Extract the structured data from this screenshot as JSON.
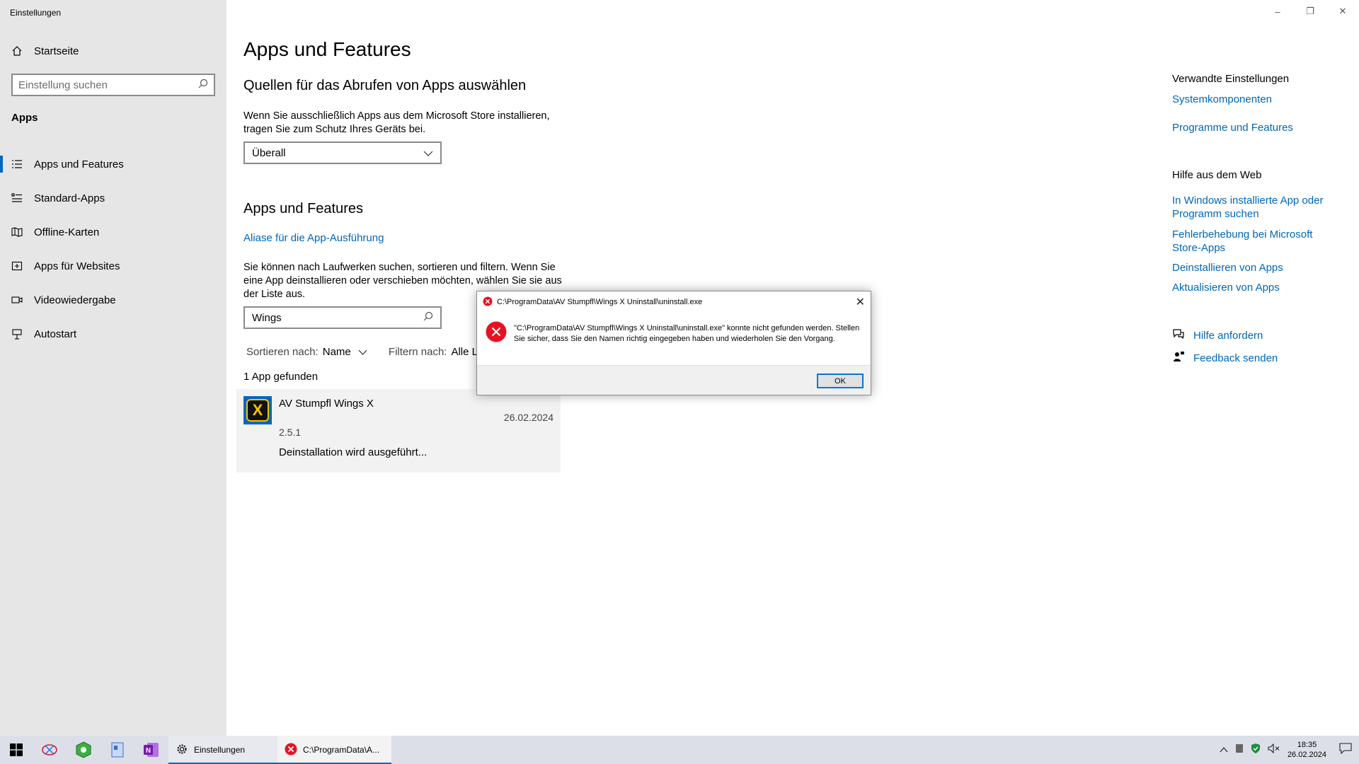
{
  "window": {
    "title": "Einstellungen",
    "controls": {
      "minimize": "–",
      "restore": "❐",
      "close": "✕"
    }
  },
  "sidebar": {
    "home": "Startseite",
    "search_placeholder": "Einstellung suchen",
    "section": "Apps",
    "items": [
      {
        "label": "Apps und Features",
        "icon": "list-icon",
        "active": true
      },
      {
        "label": "Standard-Apps",
        "icon": "default-apps-icon",
        "active": false
      },
      {
        "label": "Offline-Karten",
        "icon": "map-icon",
        "active": false
      },
      {
        "label": "Apps für Websites",
        "icon": "web-apps-icon",
        "active": false
      },
      {
        "label": "Videowiedergabe",
        "icon": "video-icon",
        "active": false
      },
      {
        "label": "Autostart",
        "icon": "startup-icon",
        "active": false
      }
    ]
  },
  "main": {
    "title": "Apps und Features",
    "source_heading": "Quellen für das Abrufen von Apps auswählen",
    "source_text": "Wenn Sie ausschließlich Apps aus dem Microsoft Store installieren, tragen Sie zum Schutz Ihres Geräts bei.",
    "source_value": "Überall",
    "apps_heading": "Apps und Features",
    "alias_link": "Aliase für die App-Ausführung",
    "search_text": "Sie können nach Laufwerken suchen, sortieren und filtern. Wenn Sie eine App deinstallieren oder verschieben möchten, wählen Sie sie aus der Liste aus.",
    "search_value": "Wings",
    "sort_label": "Sortieren nach:",
    "sort_value": "Name",
    "filter_label": "Filtern nach:",
    "filter_value": "Alle Laufwerke",
    "found": "1 App gefunden",
    "app": {
      "name": "AV Stumpfl Wings X",
      "date": "26.02.2024",
      "version": "2.5.1",
      "status": "Deinstallation wird ausgeführt..."
    }
  },
  "right": {
    "related_heading": "Verwandte Einstellungen",
    "related_links": [
      "Systemkomponenten",
      "Programme und Features"
    ],
    "web_heading": "Hilfe aus dem Web",
    "web_links": [
      "In Windows installierte App oder Programm suchen",
      "Fehlerbehebung bei Microsoft Store-Apps",
      "Deinstallieren von Apps",
      "Aktualisieren von Apps"
    ],
    "help": "Hilfe anfordern",
    "feedback": "Feedback senden"
  },
  "dialog": {
    "title": "C:\\ProgramData\\AV Stumpfl\\Wings X Uninstall\\uninstall.exe",
    "message": "\"C:\\ProgramData\\AV Stumpfl\\Wings X Uninstall\\uninstall.exe\" konnte nicht gefunden werden. Stellen Sie sicher, dass Sie den Namen richtig eingegeben haben und wiederholen Sie den Vorgang.",
    "ok": "OK"
  },
  "taskbar": {
    "apps": [
      {
        "label": "Einstellungen",
        "icon": "gear-icon"
      },
      {
        "label": "C:\\ProgramData\\A...",
        "icon": "error-icon"
      }
    ],
    "time": "18:35",
    "date": "26.02.2024"
  },
  "colors": {
    "accent": "#0067c0",
    "link": "#0067b8",
    "error": "#e81123",
    "sidebar": "#e6e6e6"
  }
}
